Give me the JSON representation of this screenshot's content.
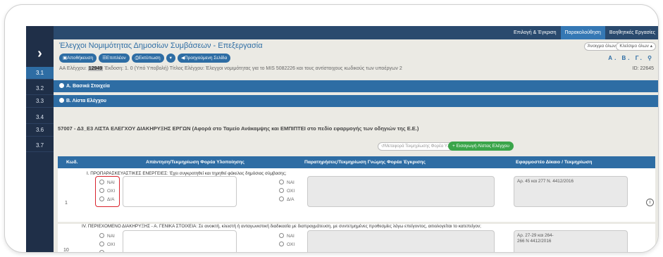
{
  "rail": {
    "items": [
      "3.1",
      "3.2",
      "3.3",
      "3.4",
      "3.6",
      "3.7"
    ],
    "active": "3.1"
  },
  "topnav": [
    "Επιλογή & Έγκριση",
    "Παρακολούθηση",
    "Βοηθητικές Εργασίες"
  ],
  "header": {
    "title": "Έλεγχοι Νομιμότητας Δημοσίων Συμβάσεων - Επεξεργασία",
    "expand_all": "Άνοιγμα όλων",
    "collapse_all": "Κλείσιμο όλων",
    "buttons": [
      "Αποθήκευση",
      "Επιπλέον",
      "Εκτύπωση",
      "Προηγούμενη Σελίδα"
    ],
    "abg": "Α. Β. Γ.",
    "info_prefix": "ΑΑ Ελέγχου:",
    "info_id": "12949",
    "info_rest": "Έκδοση: 1. 0 (Υπό Υποβολή)   Τίτλος Ελέγχου: Έλεγχοι νομιμότητας για το MIS 5082226 και τους αντίστοιχους κωδικούς των υποέργων 2",
    "id_label": "ID: 22645"
  },
  "sections": [
    "Α. Βασικά Στοιχεία",
    "Β. Λίστα Ελέγχου"
  ],
  "form_title": "57007 - Δ3_Ε3 ΛΙΣΤΑ ΕΛΕΓΧΟΥ ΔΙΑΚΗΡΥΞΗΣ ΕΡΓΩΝ (Αφορά στο Ταμείο Ανάκαμψης και ΕΜΠΙΠΤΕΙ στο πεδίο εφαρμογής των οδηγιών της Ε.Ε.)",
  "transfer_btn": "Μεταφορά Τεκμηρίωσης Φορέα Υλοποίησης",
  "import_btn": "Εισαγωγή Λίστας Ελέγχου",
  "columns": [
    "Κωδ.",
    "Απάντηση/Τεκμηρίωση Φορέα Υλοποίησης",
    "Παρατηρήσεις/Τεκμηρίωση Γνώμης Φορέα Έγκρισης",
    "Εφαρμοστέο Δίκαιο / Τεκμηρίωση"
  ],
  "rows": [
    {
      "num": "1",
      "question": "Ι. ΠΡΟΠΑΡΑΣΚΕΥΑΣΤΙΚΕΣ ΕΝΕΡΓΕΙΕΣ: Έχει συγκροτηθεί και τηρηθεί φάκελος δημόσιας σύμβασης;",
      "options": [
        "ΝΑΙ",
        "ΟΧΙ",
        "Δ/Α"
      ],
      "law": "Αρ. 45 και 277 Ν. 4412/2016"
    },
    {
      "num": "10",
      "question": "IV. ΠΕΡΙΕΧΟΜΕΝΟ ΔΙΑΚΗΡΥΞΗΣ - Α. ΓΕΝΙΚΑ ΣΤΟΙΧΕΙΑ: Σε ανοικτή, κλειστή ή ανταγωνιστική διαδικασία με διαπραγμάτευση, με συντετμημένες προθεσμίες λόγω επείγοντος, αιτιολογείται το κατεπείγον;",
      "options": [
        "ΝΑΙ",
        "ΟΧΙ",
        ""
      ],
      "law": "Αρ.  27-29  και 264-\n266 Ν 4412/2016"
    }
  ],
  "icons": {
    "info": "i",
    "plus": "+"
  }
}
